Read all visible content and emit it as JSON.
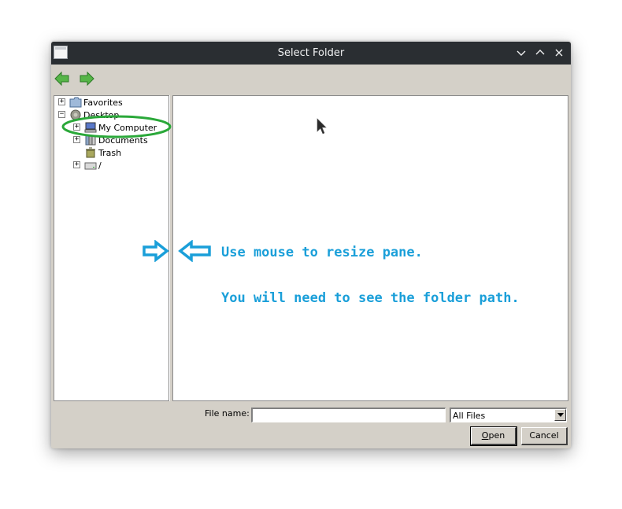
{
  "window": {
    "title": "Select Folder",
    "app_icon": "window-icon",
    "controls": {
      "minimize": "chevron-down-icon",
      "maximize": "chevron-up-icon",
      "close": "close-icon"
    }
  },
  "toolbar": {
    "back_icon": "back-arrow-icon",
    "forward_icon": "forward-arrow-icon"
  },
  "tree": {
    "items": [
      {
        "label": "Favorites",
        "icon": "folder-icon",
        "expander": "+"
      },
      {
        "label": "Desktop",
        "icon": "desktop-icon",
        "expander": "−"
      },
      {
        "label": "My Computer",
        "icon": "computer-icon",
        "expander": "+"
      },
      {
        "label": "Documents",
        "icon": "documents-icon",
        "expander": "+"
      },
      {
        "label": "Trash",
        "icon": "trash-icon"
      },
      {
        "label": "/",
        "icon": "drive-icon",
        "expander": "+"
      }
    ]
  },
  "bottom": {
    "file_name_label": "File name:",
    "file_name_value": "",
    "filter_value": "All Files",
    "open_label": "Open",
    "open_mnemonic": "O",
    "open_rest": "pen",
    "cancel_label": "Cancel"
  },
  "annotations": {
    "line1": "Use mouse to resize pane.",
    "line2": "You will need to see the folder path.",
    "color": "#1a9fd9",
    "highlight_color": "#2aa839"
  },
  "colors": {
    "titlebar": "#2a2e32",
    "dialog_bg": "#d4d0c8",
    "nav_arrow": "#3aa03a"
  }
}
